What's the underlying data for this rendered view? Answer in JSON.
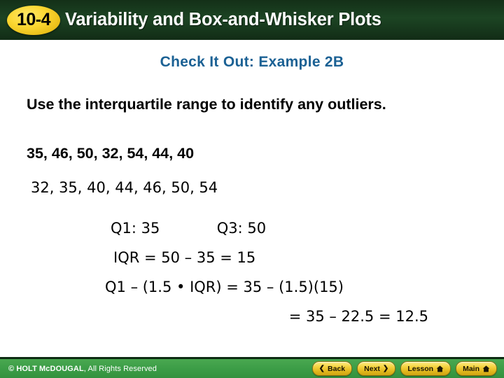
{
  "header": {
    "badge": "10-4",
    "title": "Variability and Box-and-Whisker Plots",
    "bg_color": "#1c4423",
    "badge_color": "#f5d132"
  },
  "slide": {
    "subtitle": "Check It Out: Example 2B",
    "subtitle_color": "#1b6194",
    "prompt": "Use the interquartile range to identify any outliers.",
    "dataset_raw": "35, 46, 50, 32, 54, 44, 40",
    "dataset_sorted": "32, 35, 40, 44, 46, 50, 54",
    "work": {
      "q1_label": "Q1: 35",
      "q3_label": "Q3: 50",
      "iqr_line": "IQR = 50 – 35 = 15",
      "lower_fence_line": "Q1 – (1.5 • IQR) = 35 – (1.5)(15)",
      "lower_fence_result": "= 35 – 22.5 = 12.5"
    }
  },
  "footer": {
    "copyright_mark": "© HOLT McDOUGAL",
    "copyright_rest": ", All Rights Reserved",
    "bg_color": "#3b9c46",
    "buttons": [
      {
        "label": "Back",
        "icon": "chevron-left-icon"
      },
      {
        "label": "Next",
        "icon": "chevron-right-icon"
      },
      {
        "label": "Lesson",
        "icon": "home-icon"
      },
      {
        "label": "Main",
        "icon": "home-icon"
      }
    ]
  }
}
